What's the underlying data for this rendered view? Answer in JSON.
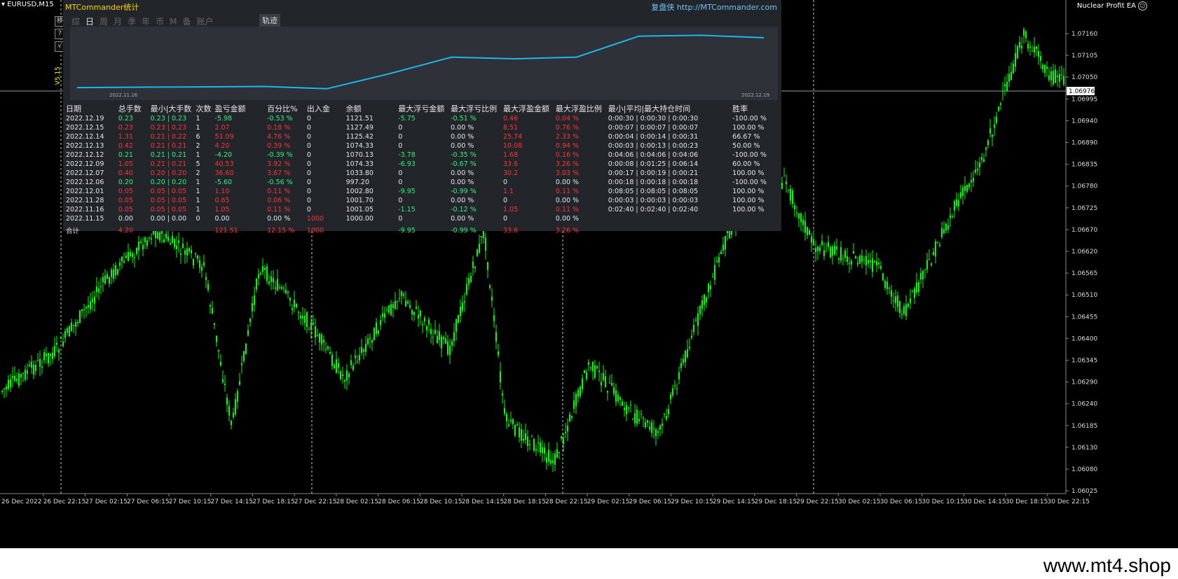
{
  "chart": {
    "symbol": "EURUSD,M15",
    "ea_name": "Nuclear Profit EA",
    "current_price": "1.06976",
    "price_ticks": [
      "1.07160",
      "1.07105",
      "1.07050",
      "1.06995",
      "1.06940",
      "1.06890",
      "1.06835",
      "1.06780",
      "1.06725",
      "1.06670",
      "1.06620",
      "1.06565",
      "1.06510",
      "1.06455",
      "1.06400",
      "1.06345",
      "1.06290",
      "1.06240",
      "1.06185",
      "1.06130",
      "1.06080",
      "1.06025"
    ],
    "time_ticks": [
      "26 Dec 2022",
      "26 Dec 22:15",
      "27 Dec 02:15",
      "27 Dec 06:15",
      "27 Dec 10:15",
      "27 Dec 14:15",
      "27 Dec 18:15",
      "27 Dec 22:15",
      "28 Dec 02:15",
      "28 Dec 06:15",
      "28 Dec 10:15",
      "28 Dec 14:15",
      "28 Dec 18:15",
      "28 Dec 22:15",
      "29 Dec 02:15",
      "29 Dec 06:15",
      "29 Dec 10:15",
      "29 Dec 14:15",
      "29 Dec 18:15",
      "29 Dec 22:15",
      "30 Dec 02:15",
      "30 Dec 06:15",
      "30 Dec 10:15",
      "30 Dec 14:15",
      "30 Dec 18:15",
      "30 Dec 22:15"
    ],
    "candle_color": "#00ff00",
    "background": "#000000"
  },
  "side_tools": [
    "移",
    "?",
    "√"
  ],
  "side_version": "V5.15",
  "panel": {
    "title": "MTCommander统计",
    "site": "复盘侠 http://MTCommander.com",
    "tabs": [
      "综",
      "日",
      "周",
      "月",
      "季",
      "年",
      "币",
      "M",
      "备",
      "账户"
    ],
    "active_tab": "日",
    "track_button": "轨迹",
    "equity_start_date": "2022.11.16",
    "equity_end_date": "2022.12.19",
    "equity_values": [
      1000.0,
      1001.05,
      1001.7,
      1002.8,
      997.2,
      1033.8,
      1074.33,
      1070.13,
      1074.33,
      1125.42,
      1127.49,
      1121.51
    ],
    "headers": [
      "日期",
      "总手数",
      "最小|大手数",
      "次数",
      "盈亏金额",
      "百分比%",
      "出入金",
      "余额",
      "最大浮亏金额",
      "最大浮亏比例",
      "最大浮盈金额",
      "最大浮盈比例",
      "最小|平均|最大持仓时间",
      "胜率"
    ],
    "rows": [
      {
        "date": "2022.12.19",
        "lots": "0.23",
        "minmax": "0.23 | 0.23",
        "count": "1",
        "pl": "-5.98",
        "pct": "-0.53 %",
        "io": "0",
        "bal": "1121.51",
        "mdd": "-5.75",
        "mddp": "-0.51 %",
        "mfp": "0.46",
        "mfpp": "0.04 %",
        "hold": "0:00:30 | 0:00:30 | 0:00:30",
        "win": "-100.00 %",
        "c": "g"
      },
      {
        "date": "2022.12.15",
        "lots": "0.23",
        "minmax": "0.23 | 0.23",
        "count": "1",
        "pl": "2.07",
        "pct": "0.18 %",
        "io": "0",
        "bal": "1127.49",
        "mdd": "0",
        "mddp": "0.00 %",
        "mfp": "8.51",
        "mfpp": "0.76 %",
        "hold": "0:00:07 | 0:00:07 | 0:00:07",
        "win": "100.00 %",
        "c": "r"
      },
      {
        "date": "2022.12.14",
        "lots": "1.31",
        "minmax": "0.21 | 0.22",
        "count": "6",
        "pl": "51.09",
        "pct": "4.76 %",
        "io": "0",
        "bal": "1125.42",
        "mdd": "0",
        "mddp": "0.00 %",
        "mfp": "25.74",
        "mfpp": "2.33 %",
        "hold": "0:00:04 | 0:00:14 | 0:00:31",
        "win": "66.67 %",
        "c": "r"
      },
      {
        "date": "2022.12.13",
        "lots": "0.42",
        "minmax": "0.21 | 0.21",
        "count": "2",
        "pl": "4.20",
        "pct": "0.39 %",
        "io": "0",
        "bal": "1074.33",
        "mdd": "0",
        "mddp": "0.00 %",
        "mfp": "10.08",
        "mfpp": "0.94 %",
        "hold": "0:00:03 | 0:00:13 | 0:00:23",
        "win": "50.00 %",
        "c": "r"
      },
      {
        "date": "2022.12.12",
        "lots": "0.21",
        "minmax": "0.21 | 0.21",
        "count": "1",
        "pl": "-4.20",
        "pct": "-0.39 %",
        "io": "0",
        "bal": "1070.13",
        "mdd": "-3.78",
        "mddp": "-0.35 %",
        "mfp": "1.68",
        "mfpp": "0.16 %",
        "hold": "0:04:06 | 0:04:06 | 0:04:06",
        "win": "-100.00 %",
        "c": "g"
      },
      {
        "date": "2022.12.09",
        "lots": "1.05",
        "minmax": "0.21 | 0.21",
        "count": "5",
        "pl": "40.53",
        "pct": "3.92 %",
        "io": "0",
        "bal": "1074.33",
        "mdd": "-6.93",
        "mddp": "-0.67 %",
        "mfp": "33.6",
        "mfpp": "3.26 %",
        "hold": "0:00:08 | 0:01:25 | 0:06:14",
        "win": "60.00 %",
        "c": "r"
      },
      {
        "date": "2022.12.07",
        "lots": "0.40",
        "minmax": "0.20 | 0.20",
        "count": "2",
        "pl": "36.60",
        "pct": "3.67 %",
        "io": "0",
        "bal": "1033.80",
        "mdd": "0",
        "mddp": "0.00 %",
        "mfp": "30.2",
        "mfpp": "3.03 %",
        "hold": "0:00:17 | 0:00:19 | 0:00:21",
        "win": "100.00 %",
        "c": "r"
      },
      {
        "date": "2022.12.06",
        "lots": "0.20",
        "minmax": "0.20 | 0.20",
        "count": "1",
        "pl": "-5.60",
        "pct": "-0.56 %",
        "io": "0",
        "bal": "997.20",
        "mdd": "0",
        "mddp": "0.00 %",
        "mfp": "0",
        "mfpp": "0.00 %",
        "hold": "0:00:18 | 0:00:18 | 0:00:18",
        "win": "-100.00 %",
        "c": "g"
      },
      {
        "date": "2022.12.01",
        "lots": "0.05",
        "minmax": "0.05 | 0.05",
        "count": "1",
        "pl": "1.10",
        "pct": "0.11 %",
        "io": "0",
        "bal": "1002.80",
        "mdd": "-9.95",
        "mddp": "-0.99 %",
        "mfp": "1.1",
        "mfpp": "0.11 %",
        "hold": "0:08:05 | 0:08:05 | 0:08:05",
        "win": "100.00 %",
        "c": "r"
      },
      {
        "date": "2022.11.28",
        "lots": "0.05",
        "minmax": "0.05 | 0.05",
        "count": "1",
        "pl": "0.65",
        "pct": "0.06 %",
        "io": "0",
        "bal": "1001.70",
        "mdd": "0",
        "mddp": "0.00 %",
        "mfp": "0",
        "mfpp": "0.00 %",
        "hold": "0:00:03 | 0:00:03 | 0:00:03",
        "win": "100.00 %",
        "c": "r"
      },
      {
        "date": "2022.11.16",
        "lots": "0.05",
        "minmax": "0.05 | 0.05",
        "count": "1",
        "pl": "1.05",
        "pct": "0.11 %",
        "io": "0",
        "bal": "1001.05",
        "mdd": "-1.15",
        "mddp": "-0.12 %",
        "mfp": "1.05",
        "mfpp": "0.11 %",
        "hold": "0:02:40 | 0:02:40 | 0:02:40",
        "win": "100.00 %",
        "c": "r"
      },
      {
        "date": "2022.11.15",
        "lots": "0.00",
        "minmax": "0.00 | 0.00",
        "count": "0",
        "pl": "0.00",
        "pct": "0.00 %",
        "io": "1000",
        "bal": "1000.00",
        "mdd": "0",
        "mddp": "0.00 %",
        "mfp": "0",
        "mfpp": "0.00 %",
        "hold": "",
        "win": "",
        "c": "w"
      }
    ],
    "total": {
      "label": "合计",
      "lots": "4.20",
      "pl": "121.51",
      "pct": "12.15 %",
      "io": "1000",
      "mdd": "-9.95",
      "mddp": "-0.99 %",
      "mfp": "33.6",
      "mfpp": "3.26 %"
    }
  },
  "footer": {
    "url": "www.mt4.shop"
  },
  "colors": {
    "profit": "#ff3333",
    "loss": "#2ef47a",
    "equity_line": "#1fb6f0",
    "panel_bg": "#22252a"
  }
}
